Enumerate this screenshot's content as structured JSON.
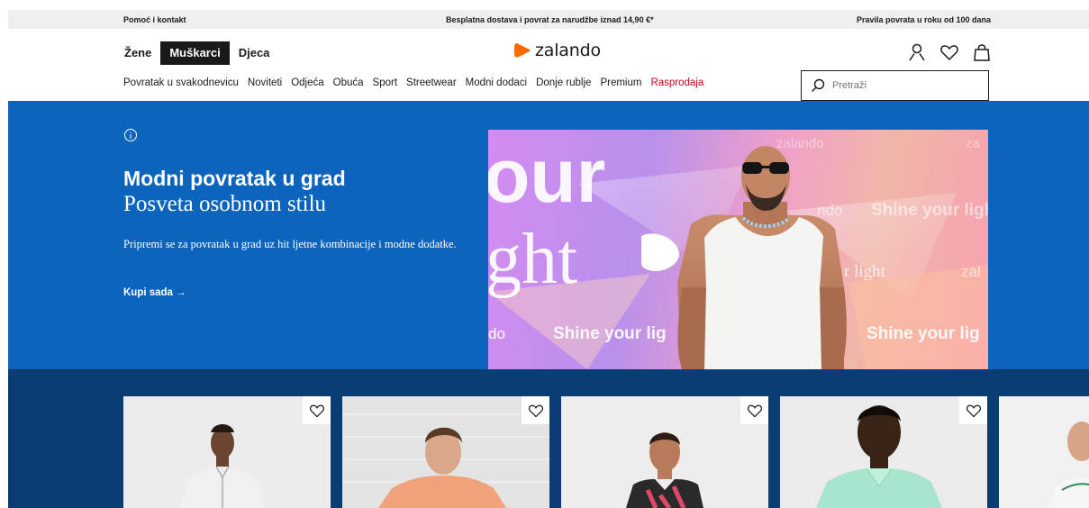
{
  "topbar": {
    "help": "Pomoć i kontakt",
    "shipping": "Besplatna dostava i povrat za narudžbe iznad 14,90 €*",
    "returns": "Pravila povrata u roku od 100 dana"
  },
  "header": {
    "tabs": [
      "Žene",
      "Muškarci",
      "Djeca"
    ],
    "active_tab": "Muškarci",
    "logo_text": "zalando",
    "icons": [
      "user-icon",
      "heart-icon",
      "bag-icon"
    ]
  },
  "nav": {
    "items": [
      "Povratak u svakodnevicu",
      "Noviteti",
      "Odjeća",
      "Obuća",
      "Sport",
      "Streetwear",
      "Modni dodaci",
      "Donje rublje",
      "Premium",
      "Rasprodaja"
    ]
  },
  "search": {
    "placeholder": "Pretraži"
  },
  "hero": {
    "title": "Modni povratak u grad",
    "subtitle": "Posveta osobnom stilu",
    "text": "Pripremi se za povratak u grad uz hit ljetne kombinacije i modne dodatke.",
    "cta": "Kupi sada →",
    "image_texts": {
      "big1": "our",
      "big2": "ght",
      "shine1": "Shine your lig",
      "shine2": "Shine your lig",
      "shine3": "Shine your ligh",
      "light": "r light",
      "do": "do",
      "zalando1": "zalando",
      "zalando2": "zal",
      "zalando3": "za",
      "ndo": "ndo"
    }
  },
  "colors": {
    "hero_bg": "#0c64bd",
    "products_bg": "#0b3d75",
    "brand": "#ff6900",
    "sale": "#d0021b"
  }
}
